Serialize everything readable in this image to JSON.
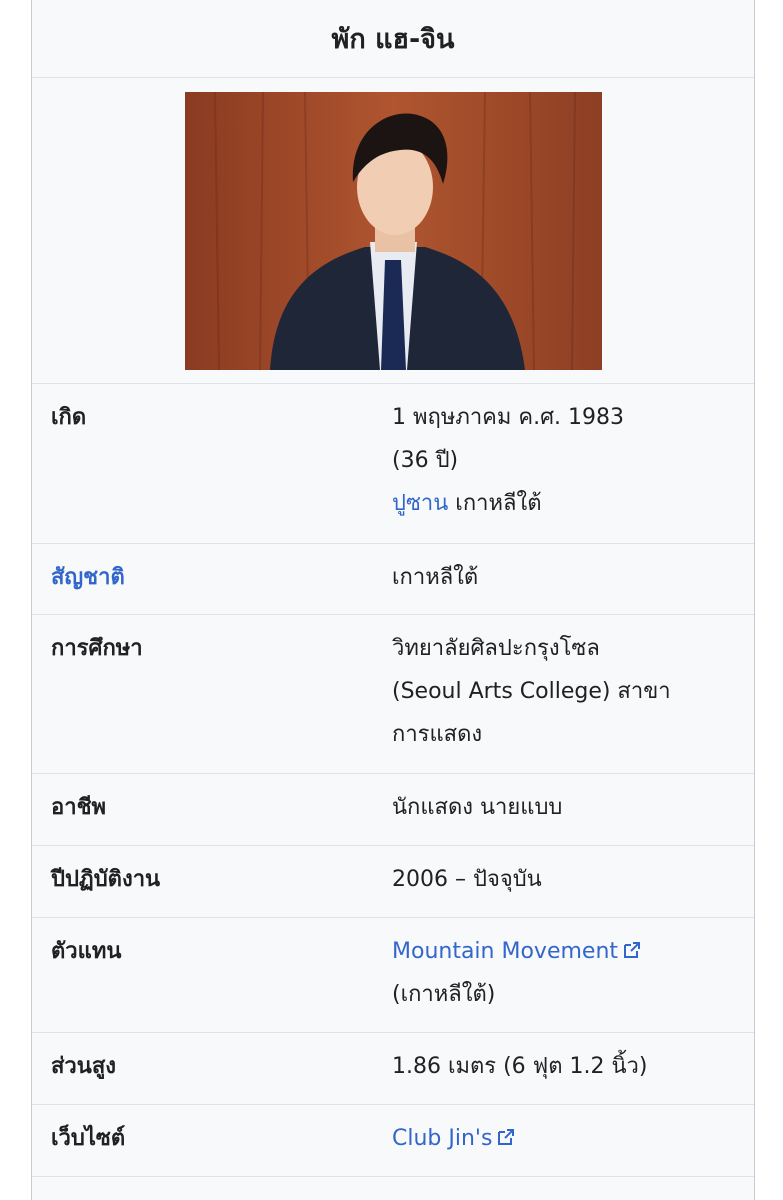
{
  "title": "พัก แฮ-จิน",
  "rows": {
    "birth": {
      "label": "เกิด",
      "line1": "1 พฤษภาคม ค.ศ. 1983",
      "line2": "(36 ปี)",
      "place_link": "ปูซาน",
      "place_text": "เกาหลีใต้"
    },
    "nationality": {
      "label": "สัญชาติ",
      "value": "เกาหลีใต้"
    },
    "education": {
      "label": "การศึกษา",
      "line1": "วิทยาลัยศิลปะกรุงโซล",
      "line2": "(Seoul Arts College) สาขา",
      "line3": "การแสดง"
    },
    "occupation": {
      "label": "อาชีพ",
      "value": "นักแสดง นายแบบ"
    },
    "years_active": {
      "label": "ปีปฏิบัติงาน",
      "value": "2006 – ปัจจุบัน"
    },
    "agent": {
      "label": "ตัวแทน",
      "link": "Mountain Movement",
      "line2": "(เกาหลีใต้)"
    },
    "height": {
      "label": "ส่วนสูง",
      "value": "1.86 เมตร (6 ฟุต 1.2 นิ้ว)"
    },
    "website": {
      "label": "เว็บไซต์",
      "link": "Club Jin's"
    }
  },
  "colors": {
    "link": "#3366cc",
    "background": "#f8f9fa",
    "border": "#dfe2e6"
  },
  "icons": {
    "external_link": "external-link-icon"
  }
}
